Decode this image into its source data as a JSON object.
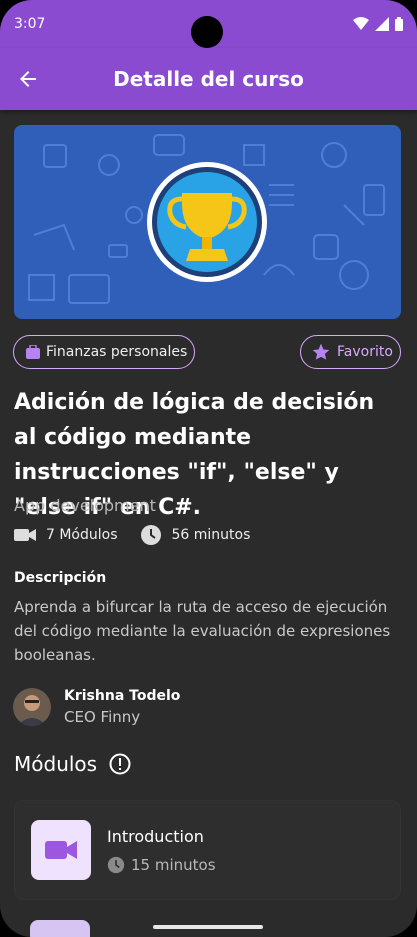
{
  "status_bar": {
    "time": "3:07"
  },
  "app_bar": {
    "title": "Detalle del curso",
    "back_icon": "arrow-left-icon"
  },
  "banner": {
    "icon": "trophy-icon",
    "background": "#2f5fb8"
  },
  "chips": {
    "category": "Finanzas personales",
    "favorite": "Favorito"
  },
  "course": {
    "title": "Adición de lógica de decisión al código mediante instrucciones \"if\", \"else\" y \"else if\" en C#.",
    "category": "App development",
    "modules_count": "7 Módulos",
    "duration": "56 minutos"
  },
  "description": {
    "heading": "Descripción",
    "text": "Aprenda a bifurcar la ruta de acceso de ejecución del código mediante la evaluación de expresiones booleanas."
  },
  "author": {
    "name": "Krishna Todelo",
    "role": "CEO Finny"
  },
  "modules": {
    "heading": "Módulos",
    "items": [
      {
        "name": "Introduction",
        "duration": "15 minutos"
      }
    ]
  },
  "colors": {
    "accent": "#8a4bd0",
    "chip_border": "#d7a8ff",
    "background": "#2b2b2b"
  }
}
